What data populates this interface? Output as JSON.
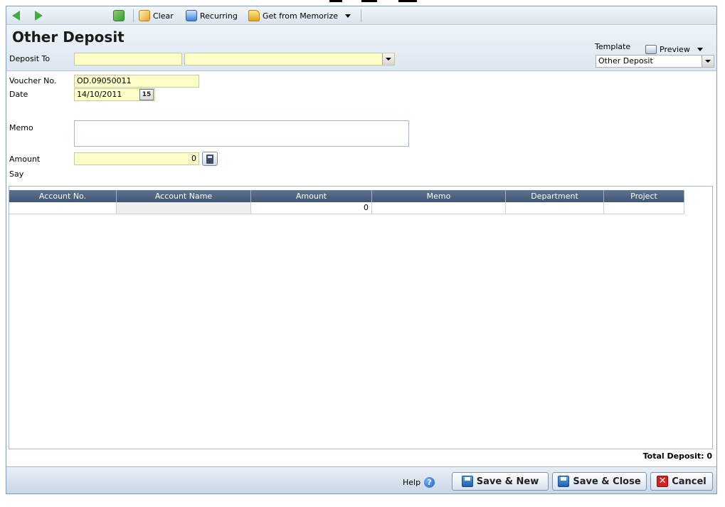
{
  "toolbar": {
    "clear_label": "Clear",
    "recurring_label": "Recurring",
    "memorize_label": "Get from Memorize"
  },
  "header": {
    "title": "Other Deposit",
    "deposit_to_label": "Deposit To",
    "deposit_to_value": "",
    "deposit_to_name": "",
    "template_label": "Template",
    "template_value": "Other Deposit",
    "preview_label": "Preview"
  },
  "form": {
    "voucher_label": "Voucher No.",
    "voucher_value": "OD.09050011",
    "date_label": "Date",
    "date_value": "14/10/2011",
    "date_icon_text": "15",
    "memo_label": "Memo",
    "memo_value": "",
    "amount_label": "Amount",
    "amount_value": "0",
    "say_label": "Say"
  },
  "grid": {
    "columns": [
      "Account No.",
      "Account Name",
      "Amount",
      "Memo",
      "Department",
      "Project"
    ],
    "rows": [
      {
        "account_no": "",
        "account_name": "",
        "amount": "0",
        "memo": "",
        "department": "",
        "project": ""
      }
    ]
  },
  "totals": {
    "total_deposit": "Total Deposit: 0"
  },
  "footer": {
    "help_label": "Help",
    "save_new_label": "Save & New",
    "save_close_label": "Save & Close",
    "cancel_label": "Cancel"
  }
}
